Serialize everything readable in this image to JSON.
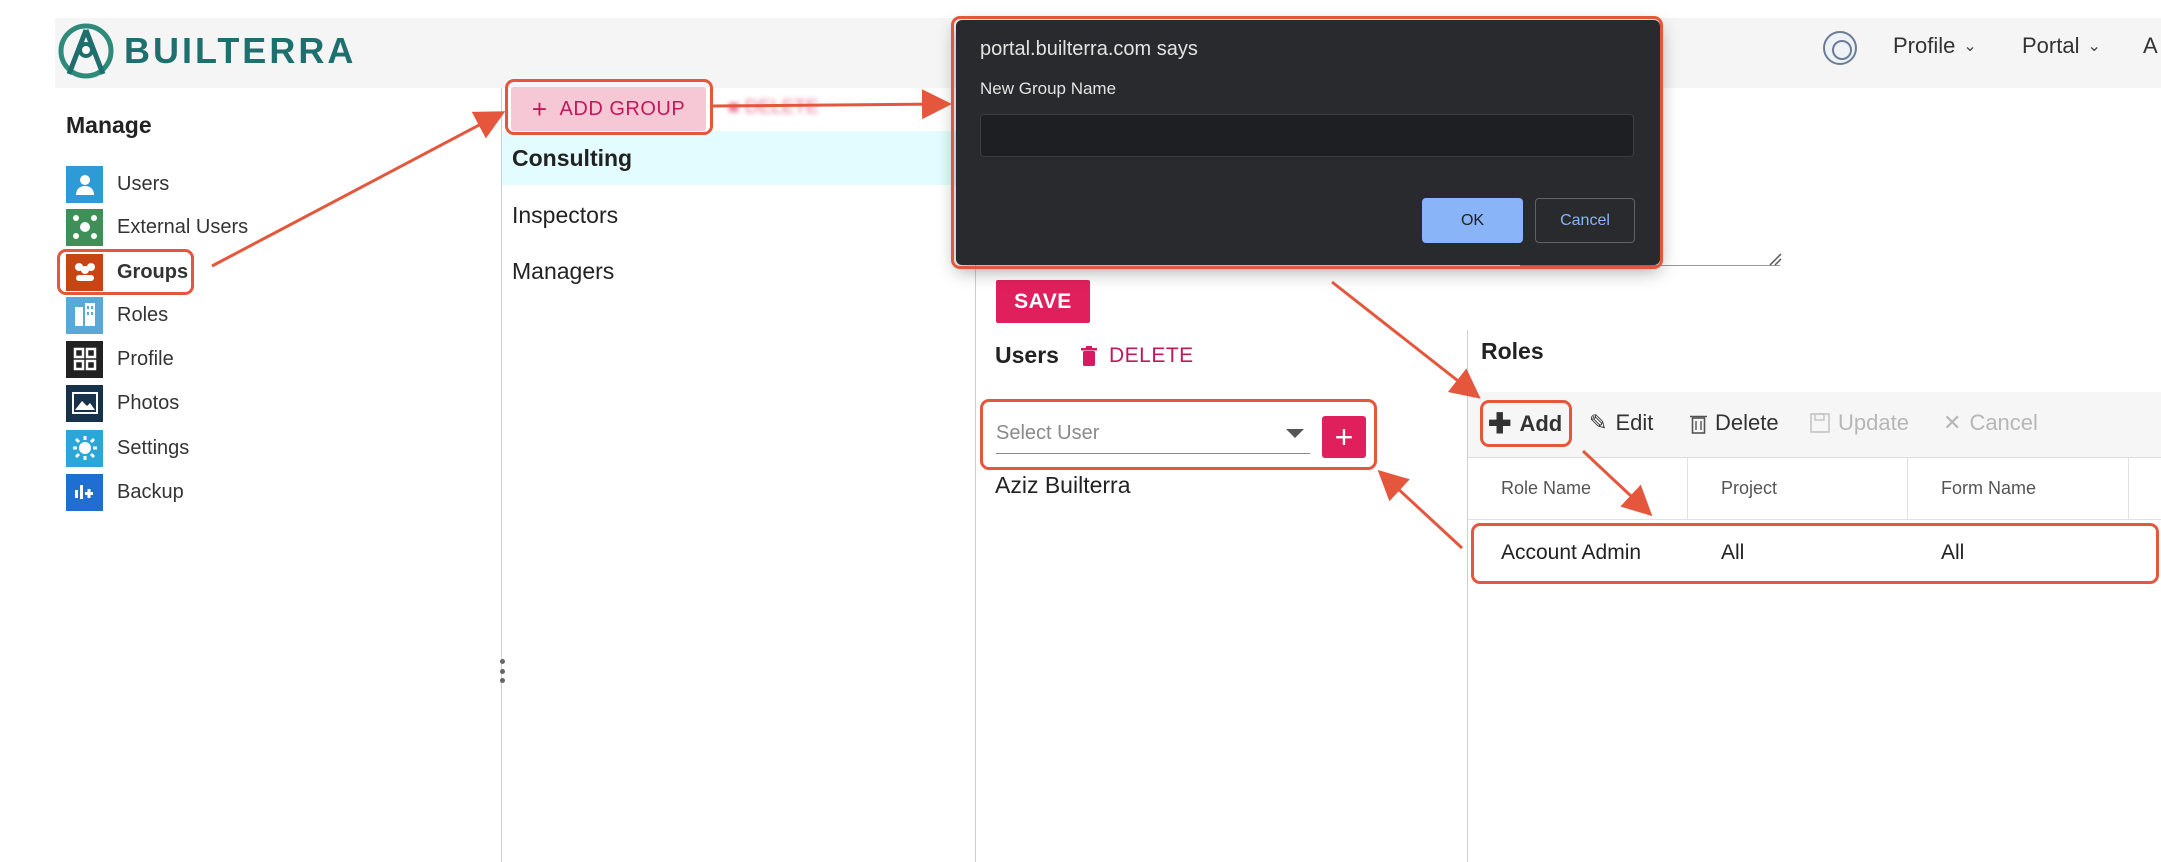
{
  "app": {
    "brand": "BUILTERRA",
    "accent": "#e0205c",
    "brand_color": "#1f6f6f"
  },
  "topnav": {
    "seal_icon": "city-seal-icon",
    "items": [
      {
        "label": "Profile",
        "icon": "chevron-down-icon"
      },
      {
        "label": "Portal",
        "icon": "chevron-down-icon"
      },
      {
        "label": "A"
      }
    ]
  },
  "sidebar": {
    "heading": "Manage",
    "items": [
      {
        "label": "Users",
        "icon": "user-icon",
        "color": "#2f9bd6"
      },
      {
        "label": "External Users",
        "icon": "network-icon",
        "color": "#3f8f58"
      },
      {
        "label": "Groups",
        "icon": "people-group-icon",
        "color": "#c64512",
        "active": true
      },
      {
        "label": "Roles",
        "icon": "building-icon",
        "color": "#5aa8d8"
      },
      {
        "label": "Profile",
        "icon": "grid-icon",
        "color": "#222222"
      },
      {
        "label": "Photos",
        "icon": "image-icon",
        "color": "#16324a"
      },
      {
        "label": "Settings",
        "icon": "gear-icon",
        "color": "#2aa7d8"
      },
      {
        "label": "Backup",
        "icon": "backup-icon",
        "color": "#1e6fd0"
      }
    ]
  },
  "groups": {
    "add_label": "ADD GROUP",
    "delete_label": "DELETE",
    "items": [
      "Consulting",
      "Inspectors",
      "Managers"
    ],
    "selected": "Consulting"
  },
  "detail": {
    "save_label": "SAVE",
    "users": {
      "title": "Users",
      "delete_label": "DELETE",
      "select_placeholder": "Select User",
      "list": [
        "Aziz Builterra"
      ]
    },
    "roles": {
      "title": "Roles",
      "toolbar": [
        {
          "label": "Add",
          "icon": "plus-icon",
          "enabled": true
        },
        {
          "label": "Edit",
          "icon": "pencil-icon",
          "enabled": true
        },
        {
          "label": "Delete",
          "icon": "trash-icon",
          "enabled": true
        },
        {
          "label": "Update",
          "icon": "save-icon",
          "enabled": false
        },
        {
          "label": "Cancel",
          "icon": "x-icon",
          "enabled": false
        }
      ],
      "columns": [
        "Role Name",
        "Project",
        "Form Name"
      ],
      "rows": [
        [
          "Account Admin",
          "All",
          "All"
        ]
      ]
    }
  },
  "dialog": {
    "title": "portal.builterra.com says",
    "prompt": "New Group Name",
    "input_value": "",
    "ok_label": "OK",
    "cancel_label": "Cancel"
  },
  "annotation_color": "#e4573d"
}
